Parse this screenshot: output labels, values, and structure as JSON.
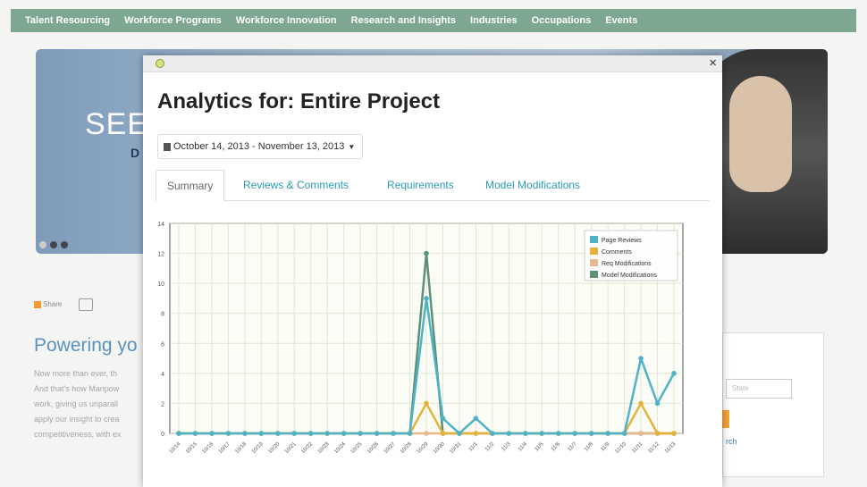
{
  "site": {
    "nav": [
      "Talent Resourcing",
      "Workforce Programs",
      "Workforce Innovation",
      "Research and Insights",
      "Industries",
      "Occupations",
      "Events"
    ],
    "hero_text": "SEE",
    "hero_sub": "D",
    "share_label": "Share",
    "heading": "Powering yo",
    "paragraph": [
      "Now more than ever, th",
      "And that's how Manpow",
      "work, giving us unparall",
      "apply our insight to crea",
      "competitiveness, with ex"
    ],
    "side_input_placeholder": "State",
    "side_link": "rch"
  },
  "modal": {
    "title": "Analytics for: Entire Project",
    "date_range": "October 14, 2013 - November 13, 2013",
    "close_label": "×",
    "tabs": [
      {
        "label": "Summary",
        "active": true
      },
      {
        "label": "Reviews & Comments",
        "active": false
      },
      {
        "label": "Requirements",
        "active": false
      },
      {
        "label": "Model Modifications",
        "active": false
      }
    ]
  },
  "chart_data": {
    "type": "line",
    "ylim": [
      0,
      14
    ],
    "yticks": [
      0,
      2,
      4,
      6,
      8,
      10,
      12,
      14
    ],
    "legend_position": "top-right",
    "x": [
      "10/14",
      "10/15",
      "10/16",
      "10/17",
      "10/18",
      "10/19",
      "10/20",
      "10/21",
      "10/22",
      "10/23",
      "10/24",
      "10/25",
      "10/26",
      "10/27",
      "10/28",
      "10/29",
      "10/30",
      "10/31",
      "11/1",
      "11/2",
      "11/3",
      "11/4",
      "11/5",
      "11/6",
      "11/7",
      "11/8",
      "11/9",
      "11/10",
      "11/11",
      "11/12",
      "11/13"
    ],
    "series": [
      {
        "name": "Page Reviews",
        "color": "#4fb3c8",
        "values": [
          0,
          0,
          0,
          0,
          0,
          0,
          0,
          0,
          0,
          0,
          0,
          0,
          0,
          0,
          0,
          9,
          1,
          0,
          1,
          0,
          0,
          0,
          0,
          0,
          0,
          0,
          0,
          0,
          5,
          2,
          4
        ]
      },
      {
        "name": "Comments",
        "color": "#e3b23c",
        "values": [
          0,
          0,
          0,
          0,
          0,
          0,
          0,
          0,
          0,
          0,
          0,
          0,
          0,
          0,
          0,
          2,
          0,
          0,
          0,
          0,
          0,
          0,
          0,
          0,
          0,
          0,
          0,
          0,
          2,
          0,
          0
        ]
      },
      {
        "name": "Req Modifications",
        "color": "#e8b98b",
        "values": [
          0,
          0,
          0,
          0,
          0,
          0,
          0,
          0,
          0,
          0,
          0,
          0,
          0,
          0,
          0,
          0,
          0,
          0,
          0,
          0,
          0,
          0,
          0,
          0,
          0,
          0,
          0,
          0,
          0,
          0,
          0
        ]
      },
      {
        "name": "Model Modifications",
        "color": "#5f8f77",
        "values": [
          0,
          0,
          0,
          0,
          0,
          0,
          0,
          0,
          0,
          0,
          0,
          0,
          0,
          0,
          0,
          12,
          0,
          0,
          0,
          0,
          0,
          0,
          0,
          0,
          0,
          0,
          0,
          0,
          0,
          0,
          0
        ]
      }
    ]
  }
}
